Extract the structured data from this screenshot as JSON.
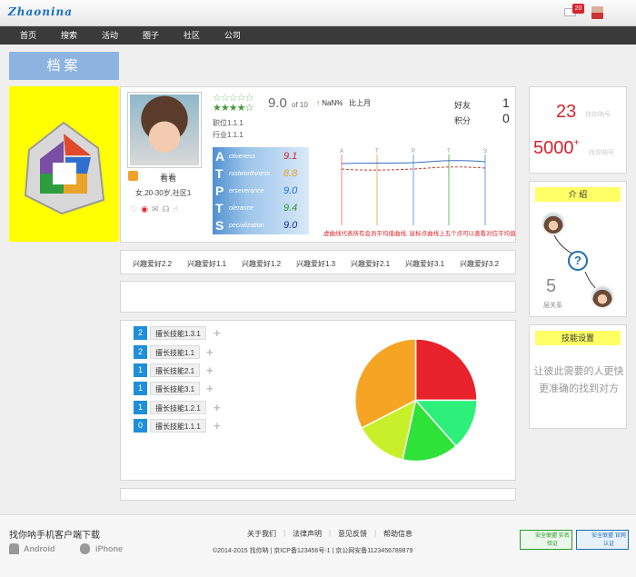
{
  "header": {
    "logo_text": "Zhaonina",
    "mail_count": "20"
  },
  "nav": {
    "items": [
      "首页",
      "搜索",
      "活动",
      "圈子",
      "社区",
      "公司"
    ]
  },
  "archive": {
    "title": "档案"
  },
  "profile": {
    "name": "看看",
    "description": "女,20-30岁,社区1",
    "score": "9.0",
    "score_of": "of 10",
    "trend_value": "NaN%",
    "trend_label": "比上月",
    "position": "职位1.1.1",
    "industry": "行业1.1.1",
    "stats": [
      {
        "label": "好友",
        "value": "1"
      },
      {
        "label": "积分",
        "value": "0"
      }
    ],
    "rating": {
      "full": 4,
      "max": 5
    }
  },
  "apts": [
    {
      "letter": "A",
      "word": "ctiveness",
      "value": "9.1",
      "color": "#d9232b"
    },
    {
      "letter": "T",
      "word": "rustworthiness",
      "value": "8.8",
      "color": "#f0a22a"
    },
    {
      "letter": "P",
      "word": "erseverance",
      "value": "9.0",
      "color": "#1e6fd8"
    },
    {
      "letter": "T",
      "word": "olerance",
      "value": "9.4",
      "color": "#2a9a2a"
    },
    {
      "letter": "S",
      "word": "pecialization",
      "value": "9.0",
      "color": "#1a2a9a"
    }
  ],
  "line_chart": {
    "axis_labels": [
      "A",
      "T",
      "P",
      "T",
      "S"
    ],
    "note": "虚曲线代表所有会员平均值曲线, 鼠标点曲线上五个点可以查看对应平均值"
  },
  "hobbies": [
    "兴趣爱好2.2",
    "兴趣爱好1.1",
    "兴趣爱好1.2",
    "兴趣爱好1.3",
    "兴趣爱好2.1",
    "兴趣爱好3.1",
    "兴趣爱好3.2"
  ],
  "skills": [
    {
      "count": "2",
      "label": "擅长技能1.3.1"
    },
    {
      "count": "2",
      "label": "擅长技能1.1"
    },
    {
      "count": "1",
      "label": "擅长技能2.1"
    },
    {
      "count": "1",
      "label": "擅长技能3.1"
    },
    {
      "count": "1",
      "label": "擅长技能1.2.1"
    },
    {
      "count": "0",
      "label": "擅长技能1.1.1"
    }
  ],
  "pie_colors": [
    "#e8222a",
    "#2cf07a",
    "#2fe23a",
    "#c8f02a",
    "#f5a423"
  ],
  "sidebar": {
    "stat1_value": "23",
    "stat1_label": "找你呐号",
    "stat2_value": "5000",
    "stat2_sup": "+",
    "stat2_label": "找你呐号",
    "intro_title": "介 绍",
    "relation_count": "5",
    "relation_label": "层关系",
    "skill_settings_title": "技能设置",
    "skill_tip": "让彼此需要的人更快更准确的找到对方"
  },
  "footer": {
    "download_title": "找你呐手机客户端下载",
    "android": "Android",
    "iphone": "iPhone",
    "links": [
      "关于我们",
      "法律声明",
      "意见反馈",
      "帮助信息"
    ],
    "copyright": "©2014-2015 找你呐 | 京ICP备123456号-1 | 京公网安备1123456789879",
    "cert1": "安全联盟 实名验证",
    "cert2": "安全联盟 官网认证"
  }
}
